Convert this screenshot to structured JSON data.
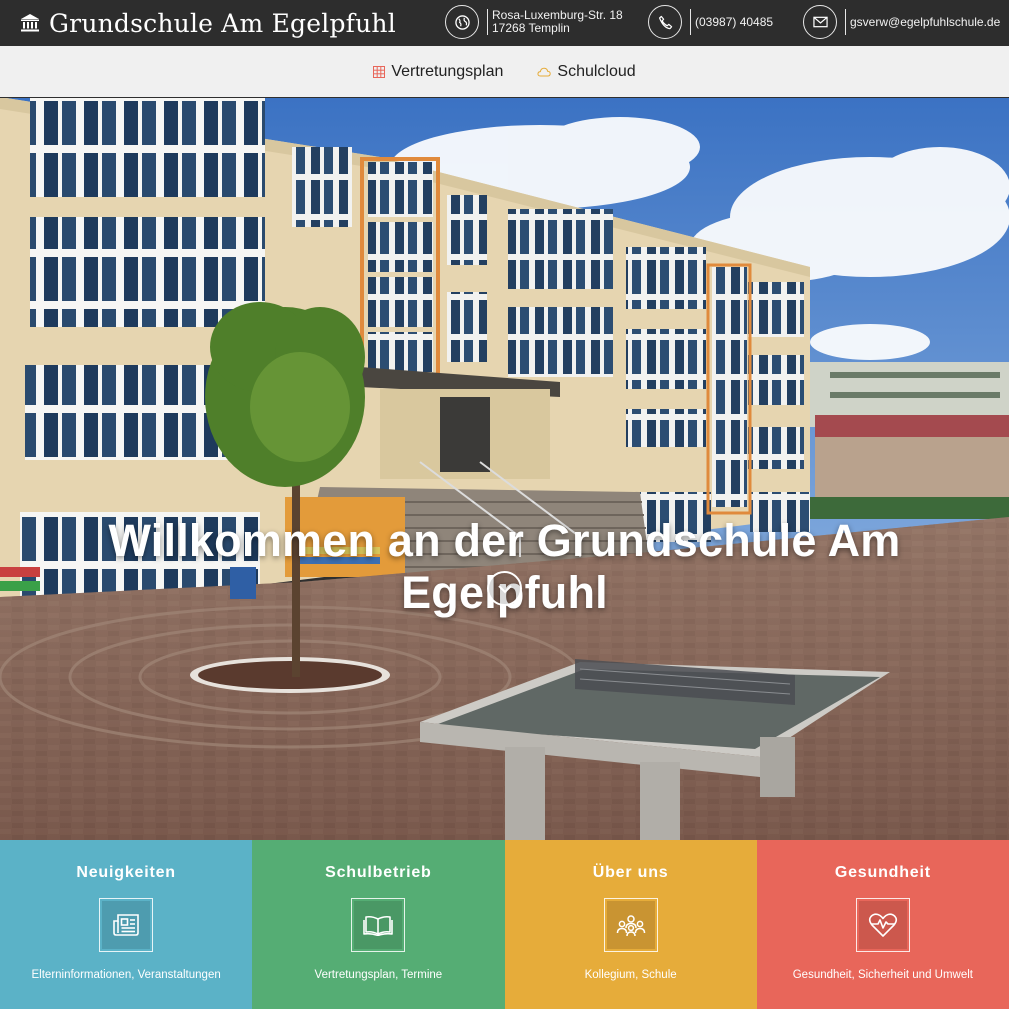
{
  "header": {
    "school_name": "Grundschule Am Egelpfuhl",
    "address_line1": "Rosa-Luxemburg-Str. 18",
    "address_line2": "17268 Templin",
    "phone": "(03987) 40485",
    "email": "gsverw@egelpfuhlschule.de"
  },
  "nav": {
    "items": [
      {
        "label": "Vertretungsplan",
        "icon": "grid-icon",
        "icon_color": "#e8665a"
      },
      {
        "label": "Schulcloud",
        "icon": "cloud-icon",
        "icon_color": "#e6ac3a"
      }
    ]
  },
  "hero": {
    "title": "Willkommen an der Grundschule Am Egelpfuhl"
  },
  "tiles": [
    {
      "title": "Neuigkeiten",
      "subtitle": "Elterninformationen, Veranstaltungen",
      "icon": "newspaper-icon",
      "color": "#5bb2c7"
    },
    {
      "title": "Schulbetrieb",
      "subtitle": "Vertretungsplan, Termine",
      "icon": "open-book-icon",
      "color": "#55ad74"
    },
    {
      "title": "Über uns",
      "subtitle": "Kollegium, Schule",
      "icon": "people-group-icon",
      "color": "#e6ac3a"
    },
    {
      "title": "Gesundheit",
      "subtitle": "Gesundheit, Sicherheit und Umwelt",
      "icon": "heart-pulse-icon",
      "color": "#e8665a"
    }
  ]
}
